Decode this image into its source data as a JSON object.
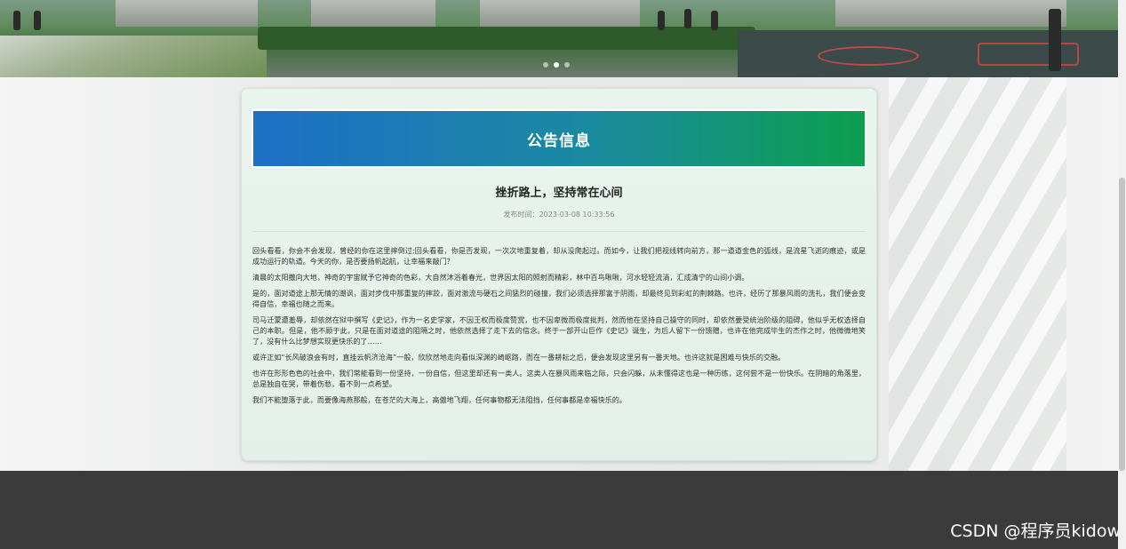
{
  "banner": {
    "carousel_dots": 3,
    "active_index": 1
  },
  "notice": {
    "header": "公告信息",
    "title": "挫折路上，坚持常在心间",
    "publish_time": "发布时间：2023-03-08 10:33:56",
    "paragraphs": [
      "回头看看，你会不会发现，曾经的你在这里摔倒过;回头看看，你是否发现，一次次地重复着，却从没爬起过。而如今，让我们把视线转向前方，那一道道金色的弧线，是流星飞逝的痕迹，或是成功运行的轨道。今天的你，是否要扬帆起航，让幸福来敲门？",
      "清晨的太阳撒向大地，神奇的宇宙赋予它神奇的色彩，大自然沐浴着春光，世界因太阳的照射而精彩，林中百鸟啾啾，河水轻轻流淌，汇成清宁的山间小调。",
      "是的，面对道途上那无情的潮讽，面对步伐中那重复的摔跤，面对激流与硬石之间猛烈的碰撞，我们必须选择那富于阴雨，却最终见到彩虹的荆棘路。也许，经历了那暴风雨的洗礼，我们便会变得自信，幸福也随之而来。",
      "司马迁蒙遭羞辱，却依然在狱中撰写《史记》，作为一名史学家，不因王权而极度赞赏，也不因卑微而极度批判，然而他在坚持自己操守的同时，却依然要受统治阶级的阻碍，他似乎无权选择自己的本职。但是，他不顾于此，只是在面对道途的阻隔之时，他依然选择了走下去的信念。终于一部开山巨作《史记》诞生，为后人留下一份馈赠，也许在他完成毕生的杰作之时，他微微地笑了，没有什么比梦想实现更快乐的了……",
      "或许正如“长风破浪会有时，直挂云帆济沧海”一般，欣欣然地走向看似深渊的崎岖路，而在一番耕耘之后，便会发现这里另有一番天地。也许这就是困难与快乐的交融。",
      "也许在形形色色的社会中，我们常能看到一份坚持，一份自信，但这里却还有一类人。这类人在暴风雨来临之际，只会闪躲，从未懂得这也是一种历练，这何尝不是一份快乐。在阴暗的角落里，总是独自在哭，带着伤愁，看不到一点希望。",
      "我们不能堕落于此，而要像海燕那般，在苍茫的大海上，高傲地飞翔，任何事物都无法阻挡，任何事都是幸福快乐的。"
    ]
  },
  "watermark": "CSDN @程序员kidow"
}
